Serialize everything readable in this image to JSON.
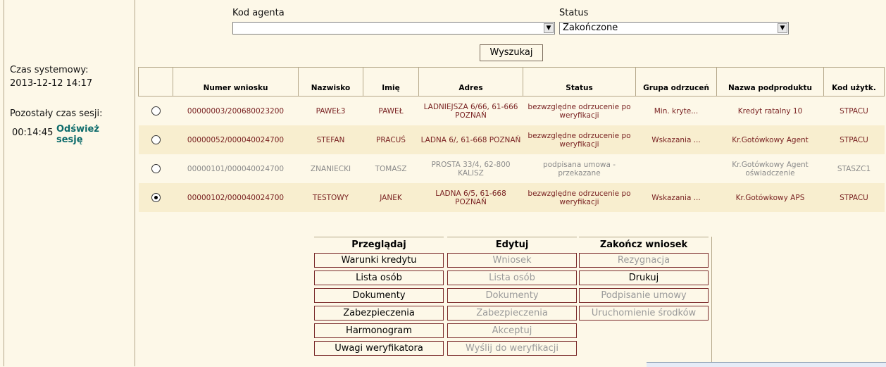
{
  "sidebar": {
    "system_time_label": "Czas systemowy:",
    "system_time_value": "2013-12-12 14:17",
    "session_label": "Pozostały czas sesji:",
    "session_time": "00:14:45",
    "refresh_label": "Odśwież sesję"
  },
  "filters": {
    "agent_label": "Kod agenta",
    "agent_value": "",
    "status_label": "Status",
    "status_value": "Zakończone",
    "search_label": "Wyszukaj"
  },
  "table": {
    "headers": [
      "Numer wniosku",
      "Nazwisko",
      "Imię",
      "Adres",
      "Status",
      "Grupa odrzuceń",
      "Nazwa podproduktu",
      "Kod użytk."
    ],
    "rows": [
      {
        "selected": false,
        "dim": false,
        "band": false,
        "cells": [
          "00000003/200680023200",
          "PAWEŁ3",
          "PAWEŁ",
          "LADNIEJSZA 6/66, 61-666 POZNAŃ",
          "bezwzględne odrzucenie po weryfikacji",
          "Min. kryte...",
          "Kredyt ratalny 10",
          "STPACU"
        ]
      },
      {
        "selected": false,
        "dim": false,
        "band": true,
        "cells": [
          "00000052/000040024700",
          "STEFAN",
          "PRACUŚ",
          "LADNA 6/, 61-668 POZNAŃ",
          "bezwzględne odrzucenie po weryfikacji",
          "Wskazania ...",
          "Kr.Gotówkowy Agent",
          "STPACU"
        ]
      },
      {
        "selected": false,
        "dim": true,
        "band": false,
        "cells": [
          "00000101/000040024700",
          "ZNANIECKI",
          "TOMASZ",
          "PROSTA 33/4, 62-800 KALISZ",
          "podpisana umowa - przekazane",
          "",
          "Kr.Gotówkowy Agent oświadczenie",
          "STASZC1"
        ]
      },
      {
        "selected": true,
        "dim": false,
        "band": true,
        "cells": [
          "00000102/000040024700",
          "TESTOWY",
          "JANEK",
          "LADNA 6/5, 61-668 POZNAŃ",
          "bezwzględne odrzucenie po weryfikacji",
          "Wskazania ...",
          "Kr.Gotówkowy APS",
          "STPACU"
        ]
      }
    ]
  },
  "actions": {
    "browse": {
      "title": "Przeglądaj",
      "items": [
        {
          "label": "Warunki kredytu",
          "enabled": true
        },
        {
          "label": "Lista osób",
          "enabled": true
        },
        {
          "label": "Dokumenty",
          "enabled": true
        },
        {
          "label": "Zabezpieczenia",
          "enabled": true
        },
        {
          "label": "Harmonogram",
          "enabled": true
        },
        {
          "label": "Uwagi weryfikatora",
          "enabled": true
        }
      ]
    },
    "edit": {
      "title": "Edytuj",
      "items": [
        {
          "label": "Wniosek",
          "enabled": false
        },
        {
          "label": "Lista osób",
          "enabled": false
        },
        {
          "label": "Dokumenty",
          "enabled": false
        },
        {
          "label": "Zabezpieczenia",
          "enabled": false
        },
        {
          "label": "Akceptuj",
          "enabled": false
        },
        {
          "label": "Wyślij do weryfikacji",
          "enabled": false
        }
      ]
    },
    "finish": {
      "title": "Zakończ wniosek",
      "items": [
        {
          "label": "Rezygnacja",
          "enabled": false
        },
        {
          "label": "Drukuj",
          "enabled": true
        },
        {
          "label": "Podpisanie umowy",
          "enabled": false
        },
        {
          "label": "Uruchomienie środków",
          "enabled": false
        }
      ]
    }
  }
}
